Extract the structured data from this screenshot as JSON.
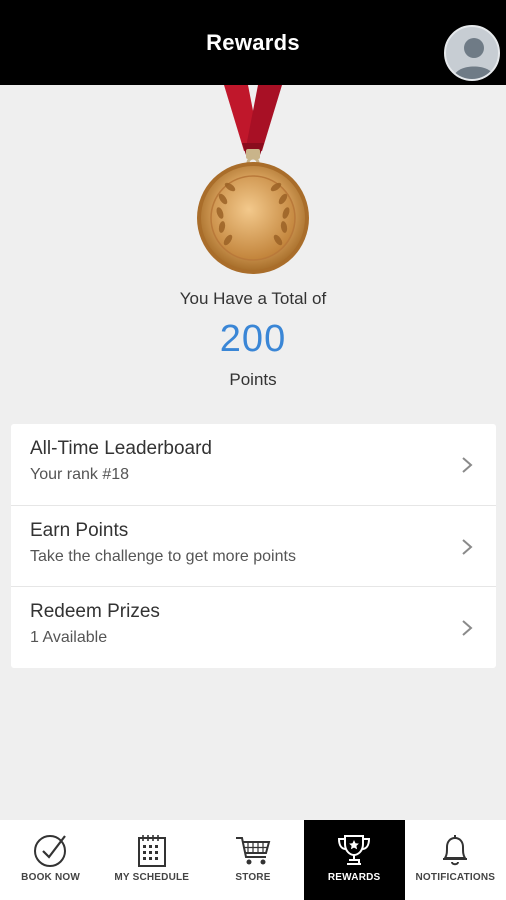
{
  "header": {
    "title": "Rewards"
  },
  "summary": {
    "label": "You Have a Total of",
    "value": "200",
    "unit": "Points"
  },
  "menu": [
    {
      "title": "All-Time Leaderboard",
      "subtitle": "Your rank #18"
    },
    {
      "title": "Earn Points",
      "subtitle": "Take the challenge to get more points"
    },
    {
      "title": "Redeem Prizes",
      "subtitle": "1 Available"
    }
  ],
  "tabs": [
    {
      "label": "BOOK NOW",
      "icon": "check-circle-icon"
    },
    {
      "label": "MY SCHEDULE",
      "icon": "calendar-icon"
    },
    {
      "label": "STORE",
      "icon": "cart-icon"
    },
    {
      "label": "REWARDS",
      "icon": "trophy-icon",
      "active": true
    },
    {
      "label": "NOTIFICATIONS",
      "icon": "bell-icon"
    }
  ],
  "colors": {
    "header_bg": "#000000",
    "points_accent": "#3a86d6",
    "ribbon": "#c0172b",
    "medal_gold": "#d9a15a",
    "background": "#efefef"
  }
}
